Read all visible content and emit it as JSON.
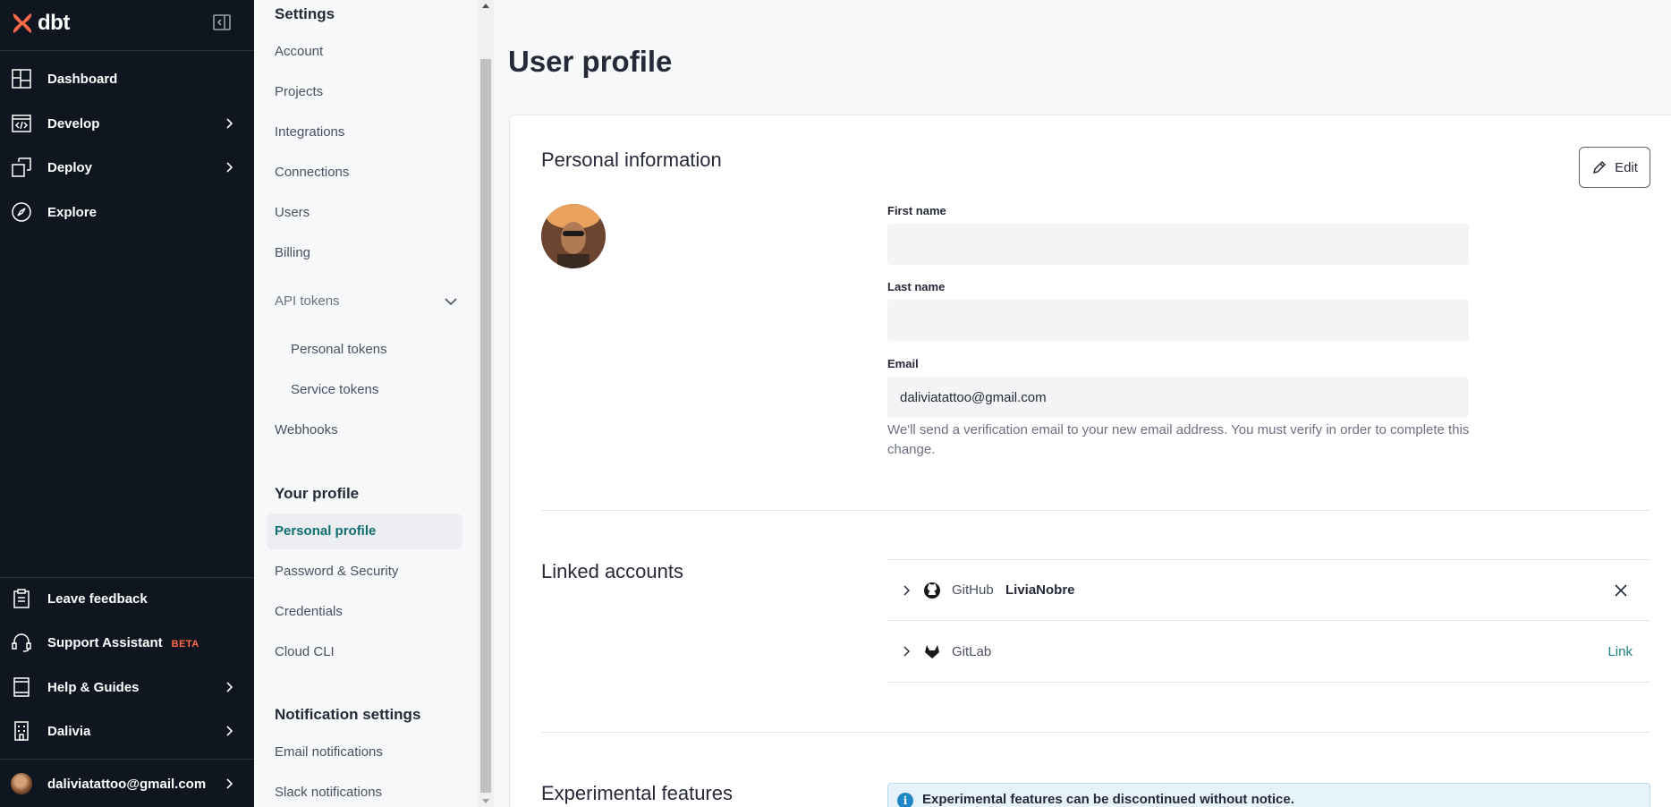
{
  "app": {
    "logo_text": "dbt"
  },
  "nav": {
    "items": [
      {
        "label": "Dashboard",
        "icon": "dashboard-icon"
      },
      {
        "label": "Develop",
        "icon": "code-icon"
      },
      {
        "label": "Deploy",
        "icon": "deploy-icon"
      },
      {
        "label": "Explore",
        "icon": "compass-icon"
      }
    ],
    "bottom": [
      {
        "label": "Leave feedback",
        "icon": "clipboard-icon"
      },
      {
        "label": "Support Assistant",
        "icon": "headset-icon",
        "badge": "BETA"
      },
      {
        "label": "Help & Guides",
        "icon": "book-icon"
      },
      {
        "label": "Dalivia",
        "icon": "building-icon"
      }
    ],
    "user_email": "daliviatattoo@gmail.com"
  },
  "settings": {
    "heading": "Settings",
    "items": [
      "Account",
      "Projects",
      "Integrations",
      "Connections",
      "Users",
      "Billing"
    ],
    "api_tokens": "API tokens",
    "api_sub": [
      "Personal tokens",
      "Service tokens"
    ],
    "webhooks": "Webhooks",
    "profile_heading": "Your profile",
    "profile_items": [
      "Personal profile",
      "Password & Security",
      "Credentials",
      "Cloud CLI"
    ],
    "notif_heading": "Notification settings",
    "notif_items": [
      "Email notifications",
      "Slack notifications"
    ]
  },
  "main": {
    "title": "User profile",
    "personal": {
      "title": "Personal information",
      "edit_label": "Edit",
      "first_name_label": "First name",
      "first_name_value": "",
      "last_name_label": "Last name",
      "last_name_value": "",
      "email_label": "Email",
      "email_value": "daliviatattoo@gmail.com",
      "email_hint": "We'll send a verification email to your new email address. You must verify in order to complete this change."
    },
    "linked": {
      "title": "Linked accounts",
      "accounts": [
        {
          "provider": "GitHub",
          "username": "LiviaNobre",
          "icon": "github-icon"
        },
        {
          "provider": "GitLab",
          "action": "Link",
          "icon": "gitlab-icon"
        }
      ]
    },
    "experimental": {
      "title": "Experimental features",
      "notice": "Experimental features can be discontinued without notice."
    }
  },
  "colors": {
    "nav_bg": "#10161f",
    "accent": "#ff694a",
    "teal": "#0f6e6f",
    "link": "#1a7f7f"
  }
}
